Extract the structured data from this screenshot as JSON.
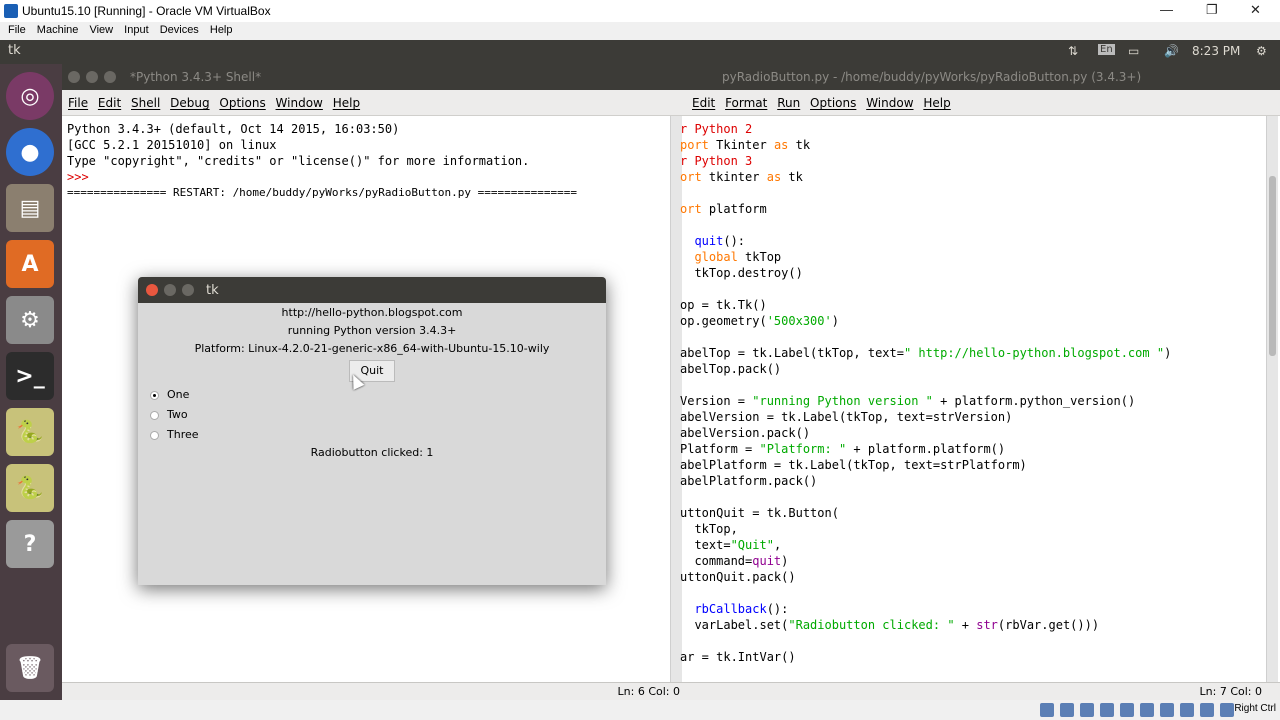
{
  "vbox": {
    "title": "Ubuntu15.10 [Running] - Oracle VM VirtualBox",
    "menu": [
      "File",
      "Machine",
      "View",
      "Input",
      "Devices",
      "Help"
    ],
    "right_ctrl": "Right Ctrl"
  },
  "panel": {
    "app_title": "tk",
    "time": "8:23 PM"
  },
  "launcher": {
    "icons": [
      "ubuntu-dash-icon",
      "chrome-icon",
      "files-icon",
      "software-center-icon",
      "settings-icon",
      "terminal-icon",
      "python-idle-icon",
      "python-idle-icon",
      "help-icon",
      "trash-icon"
    ]
  },
  "shell": {
    "title": "*Python 3.4.3+ Shell*",
    "menu": [
      "File",
      "Edit",
      "Shell",
      "Debug",
      "Options",
      "Window",
      "Help"
    ],
    "lines": [
      "Python 3.4.3+ (default, Oct 14 2015, 16:03:50)",
      "[GCC 5.2.1 20151010] on linux",
      "Type \"copyright\", \"credits\" or \"license()\" for more information.",
      ">>> ",
      "=============== RESTART: /home/buddy/pyWorks/pyRadioButton.py ==============="
    ],
    "status": "Ln: 6 Col: 0"
  },
  "editor": {
    "title": "pyRadioButton.py - /home/buddy/pyWorks/pyRadioButton.py (3.4.3+)",
    "menu": [
      "Edit",
      "Format",
      "Run",
      "Options",
      "Window",
      "Help"
    ],
    "status": "Ln: 7 Col: 0"
  },
  "tk": {
    "title": "tk",
    "url_label": "http://hello-python.blogspot.com",
    "version_label": "running Python version 3.4.3+",
    "platform_label": "Platform: Linux-4.2.0-21-generic-x86_64-with-Ubuntu-15.10-wily",
    "quit_label": "Quit",
    "radios": [
      {
        "label": "One",
        "selected": true
      },
      {
        "label": "Two",
        "selected": false
      },
      {
        "label": "Three",
        "selected": false
      }
    ],
    "status_label": "Radiobutton clicked: 1"
  },
  "colors": {
    "panel": "#3c3b37",
    "launcher": "#4a3d42",
    "idle_keyword": "#ff7700",
    "idle_string": "#00aa00",
    "idle_builtin": "#900090",
    "idle_comment": "#dd0000"
  }
}
